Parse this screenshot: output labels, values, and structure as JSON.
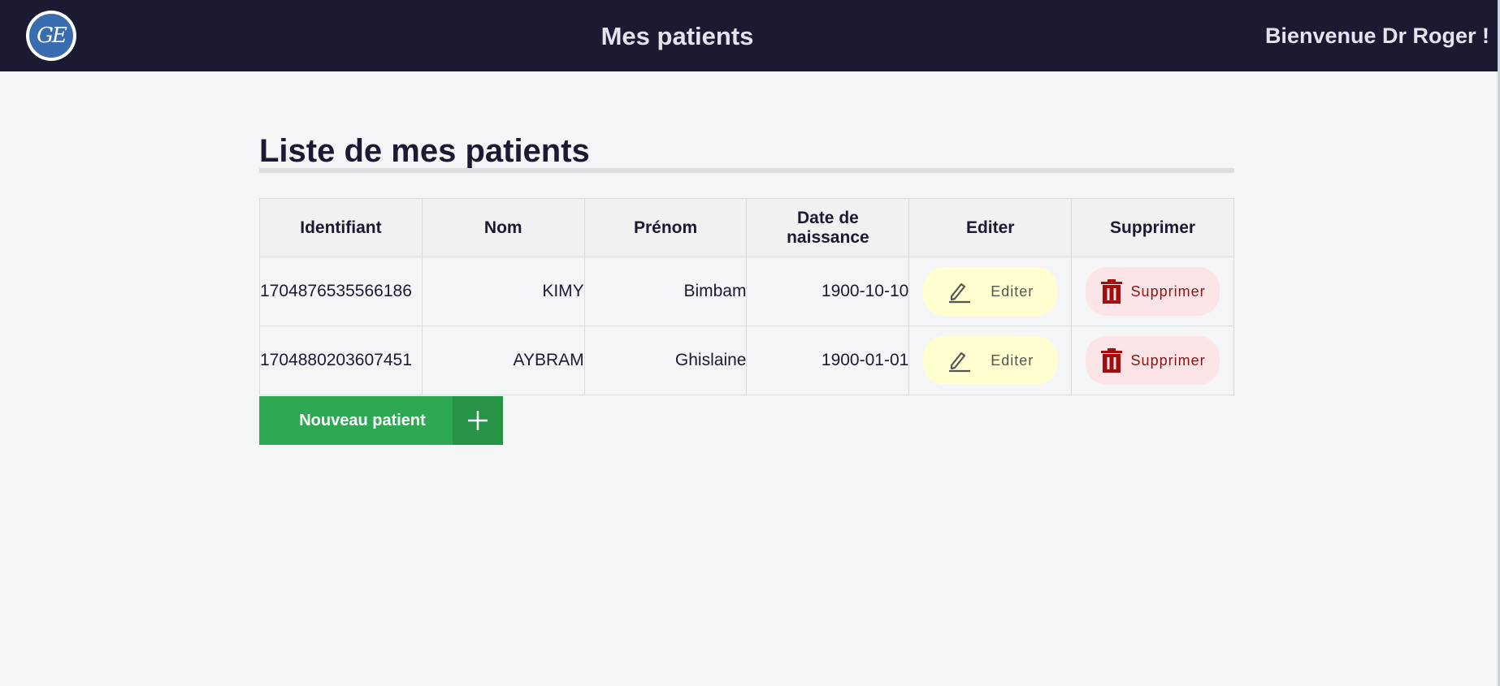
{
  "header": {
    "logo_text": "GE",
    "title": "Mes patients",
    "welcome": "Bienvenue Dr Roger !"
  },
  "main": {
    "heading": "Liste de mes patients",
    "table": {
      "columns": [
        "Identifiant",
        "Nom",
        "Prénom",
        "Date de naissance",
        "Editer",
        "Supprimer"
      ],
      "rows": [
        {
          "id": "1704876535566186",
          "nom": "KIMY",
          "prenom": "Bimbam",
          "date": "1900-10-10",
          "edit_label": "Editer",
          "delete_label": "Supprimer"
        },
        {
          "id": "1704880203607451",
          "nom": "AYBRAM",
          "prenom": "Ghislaine",
          "date": "1900-01-01",
          "edit_label": "Editer",
          "delete_label": "Supprimer"
        }
      ]
    },
    "new_button_label": "Nouveau patient"
  },
  "colors": {
    "header_bg": "#1b1a33",
    "page_bg": "#f4f5f7",
    "edit_bg": "#ffffcf",
    "delete_bg": "#fde5e7",
    "delete_icon": "#a30d0d",
    "success": "#2ea853"
  },
  "icons": {
    "logo": "ge-logo-icon",
    "edit": "pencil-icon",
    "delete": "trash-icon",
    "add": "plus-icon"
  }
}
